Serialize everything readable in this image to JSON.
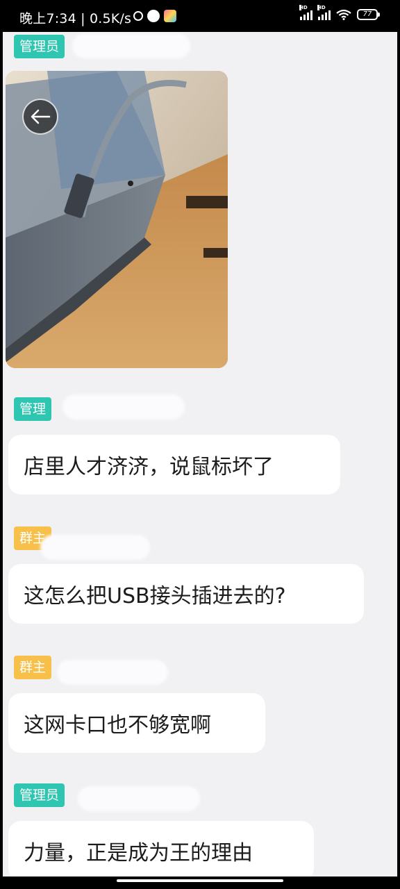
{
  "status_bar": {
    "time_speed": "晚上7:34 | 0.5K/s",
    "hd1": "HD",
    "hd2": "HD",
    "battery": "77"
  },
  "messages": [
    {
      "role_tag": "管理员",
      "type": "image"
    },
    {
      "role_tag": "管理",
      "text": "店里人才济济，说鼠标坏了"
    },
    {
      "role_tag": "群主",
      "text": "这怎么把USB接头插进去的?"
    },
    {
      "role_tag": "群主",
      "text": "这网卡口也不够宽啊"
    },
    {
      "role_tag": "管理员",
      "text": "力量，正是成为王的理由"
    }
  ],
  "colors": {
    "admin_tag": "#2fc6b1",
    "owner_tag": "#f6c04a",
    "chat_bg": "#f1f1f4",
    "bubble_bg": "#ffffff"
  },
  "icons": [
    "alarm-icon",
    "qq-icon",
    "gallery-icon",
    "signal-icon",
    "wifi-icon",
    "battery-icon",
    "back-arrow-icon"
  ]
}
